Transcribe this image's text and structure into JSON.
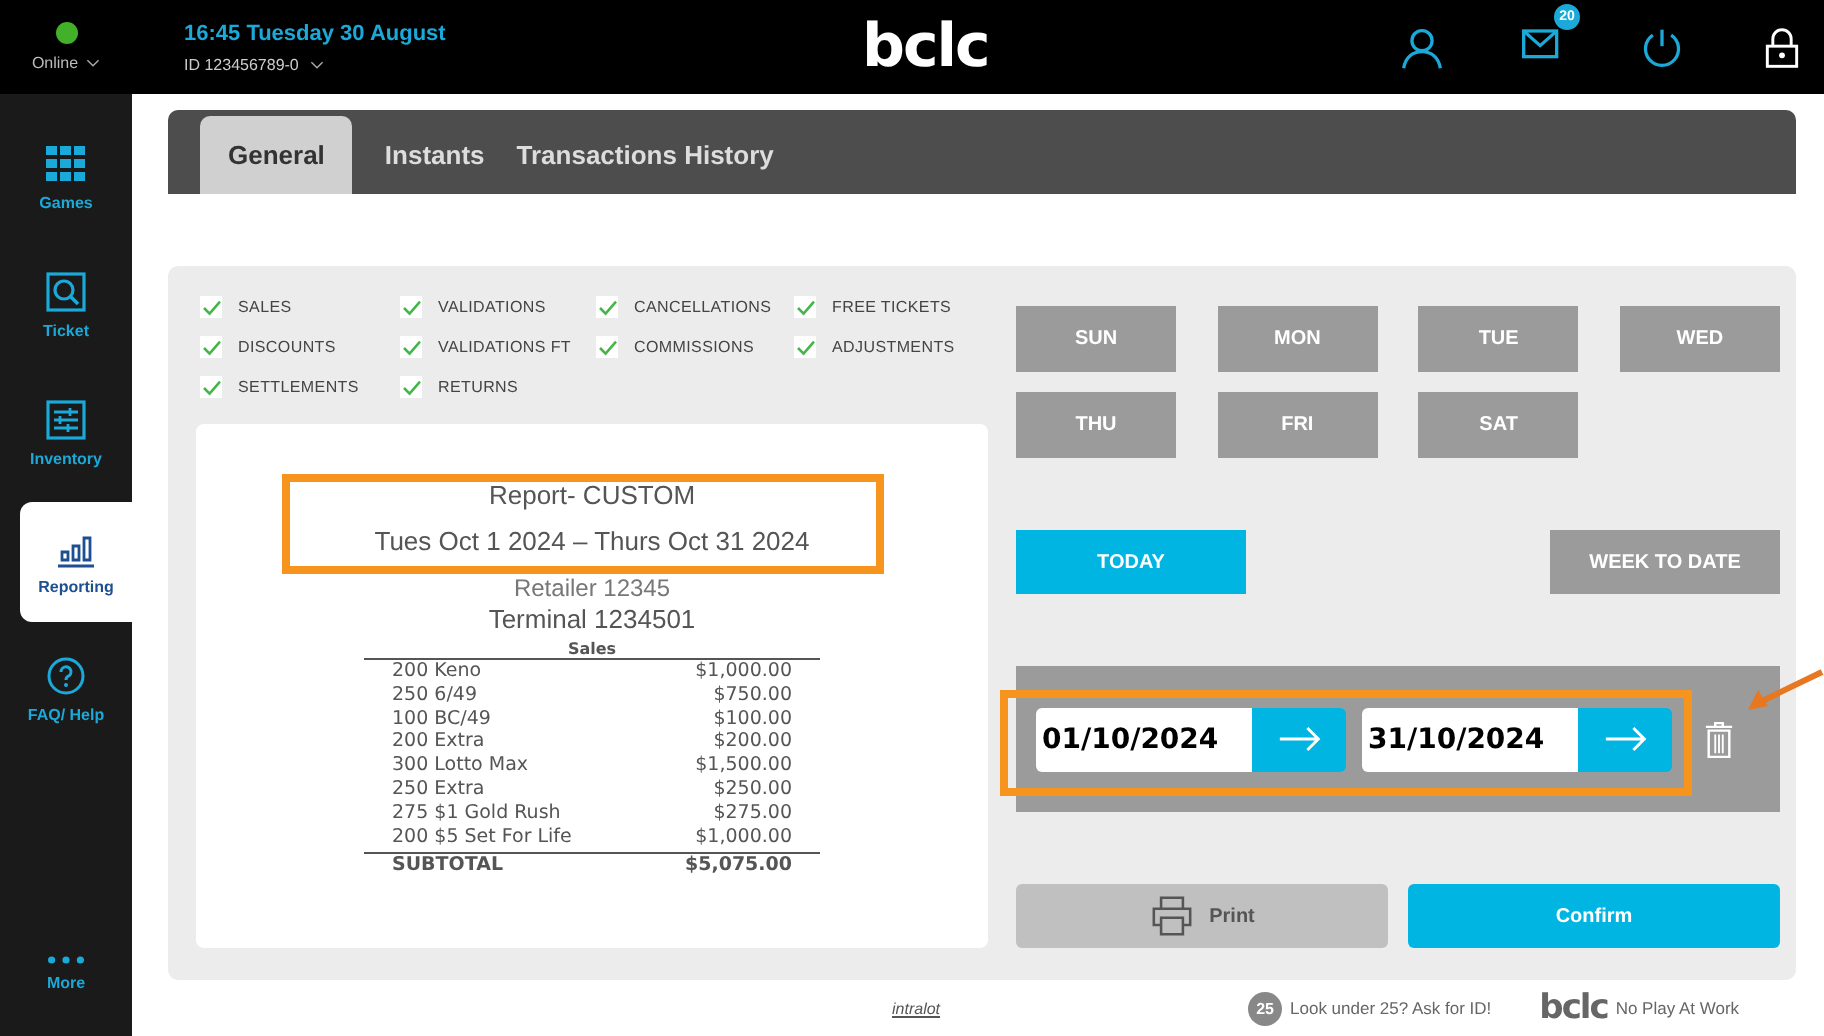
{
  "status": {
    "label": "Online",
    "online": true
  },
  "header": {
    "datetime": "16:45 Tuesday 30 August",
    "terminal_id": "ID 123456789-0",
    "logo": "bclc",
    "mail_count": "20"
  },
  "sidebar": {
    "items": [
      {
        "label": "Games",
        "kind": "grid",
        "selected": false
      },
      {
        "label": "Ticket",
        "kind": "search",
        "selected": false
      },
      {
        "label": "Inventory",
        "kind": "sliders",
        "selected": false
      },
      {
        "label": "Reporting",
        "kind": "bars",
        "selected": true
      },
      {
        "label": "FAQ/ Help",
        "kind": "help",
        "selected": false
      }
    ],
    "more": "More"
  },
  "tabs": [
    {
      "label": "General",
      "selected": true
    },
    {
      "label": "Instants",
      "selected": false
    },
    {
      "label": "Transactions History",
      "selected": false
    }
  ],
  "filters": [
    {
      "label": "SALES",
      "checked": true
    },
    {
      "label": "VALIDATIONS",
      "checked": true
    },
    {
      "label": "CANCELLATIONS",
      "checked": true
    },
    {
      "label": "FREE TICKETS",
      "checked": true
    },
    {
      "label": "DISCOUNTS",
      "checked": true
    },
    {
      "label": "VALIDATIONS FT",
      "checked": true
    },
    {
      "label": "COMMISSIONS",
      "checked": true
    },
    {
      "label": "ADJUSTMENTS",
      "checked": true
    },
    {
      "label": "SETTLEMENTS",
      "checked": true
    },
    {
      "label": "RETURNS",
      "checked": true
    }
  ],
  "report": {
    "title": "Report- CUSTOM",
    "period": "Tues Oct 1 2024 – Thurs Oct 31 2024",
    "retailer": "Retailer 12345",
    "terminal": "Terminal 1234501",
    "section": "Sales",
    "lines": [
      {
        "item": "200 Keno",
        "amount": "$1,000.00"
      },
      {
        "item": "250 6/49",
        "amount": "$750.00"
      },
      {
        "item": "100 BC/49",
        "amount": "$100.00"
      },
      {
        "item": "200 Extra",
        "amount": "$200.00"
      },
      {
        "item": "300 Lotto Max",
        "amount": "$1,500.00"
      },
      {
        "item": "250 Extra",
        "amount": "$250.00"
      },
      {
        "item": "275 $1 Gold Rush",
        "amount": "$275.00"
      },
      {
        "item": "200 $5 Set For Life",
        "amount": "$1,000.00"
      }
    ],
    "subtotal": {
      "label": "SUBTOTAL",
      "amount": "$5,075.00"
    }
  },
  "days": [
    {
      "label": "SUN",
      "selected": false
    },
    {
      "label": "MON",
      "selected": false
    },
    {
      "label": "TUE",
      "selected": false
    },
    {
      "label": "WED",
      "selected": false
    },
    {
      "label": "THU",
      "selected": false
    },
    {
      "label": "FRI",
      "selected": false
    },
    {
      "label": "SAT",
      "selected": false
    }
  ],
  "quick_ranges": [
    {
      "label": "TODAY",
      "selected": true
    },
    {
      "label": "WEEK TO DATE",
      "selected": false
    }
  ],
  "date_range": {
    "from": "01/10/2024",
    "to": "31/10/2024"
  },
  "actions": {
    "print": "Print",
    "confirm": "Confirm"
  },
  "footer": {
    "vendor": "intralot",
    "age_badge": "25",
    "age_notice": "Look under 25? Ask for ID!",
    "logo": "bclc",
    "slogan": "No Play At Work"
  }
}
